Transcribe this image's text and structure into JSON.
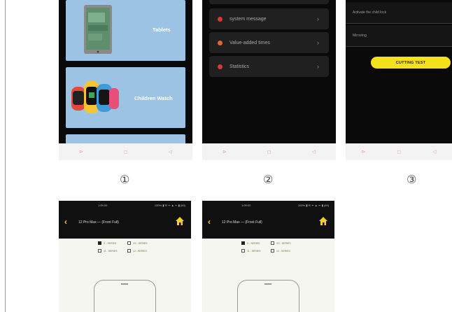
{
  "screen1": {
    "cards": [
      {
        "label": "Tablets",
        "icon": "tablet-icon"
      },
      {
        "label": "Children Watch",
        "icon": "smartwatch-icon"
      }
    ]
  },
  "screen2": {
    "menu": [
      {
        "label": "system message",
        "color": "#d23a3a"
      },
      {
        "label": "Value-added times",
        "color": "#e2682a"
      },
      {
        "label": "Statistics",
        "color": "#d23a3a"
      }
    ]
  },
  "screen3": {
    "settings": [
      {
        "label": "Activate the child lock"
      },
      {
        "label": "Mirroring"
      }
    ],
    "button_label": "CUTTING TEST"
  },
  "numbers": [
    "①",
    "②",
    "③"
  ],
  "screen4": {
    "status_left": "1:09:00",
    "status_right": "100% ▮ ✉ ᯤ ▲ ᯤ ▮ (89)",
    "title": "12 Pro Max — (Front Full)",
    "options": [
      "X - SERIES",
      "XS - SERIES",
      "11 - SERIES",
      "12 - SERIES"
    ]
  },
  "screen5": {
    "status_left": "1:09:00",
    "status_right": "100% ▮ ✉ ᯤ ▲ ᯤ ▮ (89)",
    "title": "12 Pro Max — (Front Full)",
    "options": [
      "X - SERIES",
      "XS - SERIES",
      "11 - SERIES",
      "12 - SERIES"
    ]
  },
  "navbar": [
    "⊳",
    "◻",
    "◁"
  ],
  "colors": {
    "accent": "#f5e01c",
    "card_bg": "#9dc3e4"
  }
}
